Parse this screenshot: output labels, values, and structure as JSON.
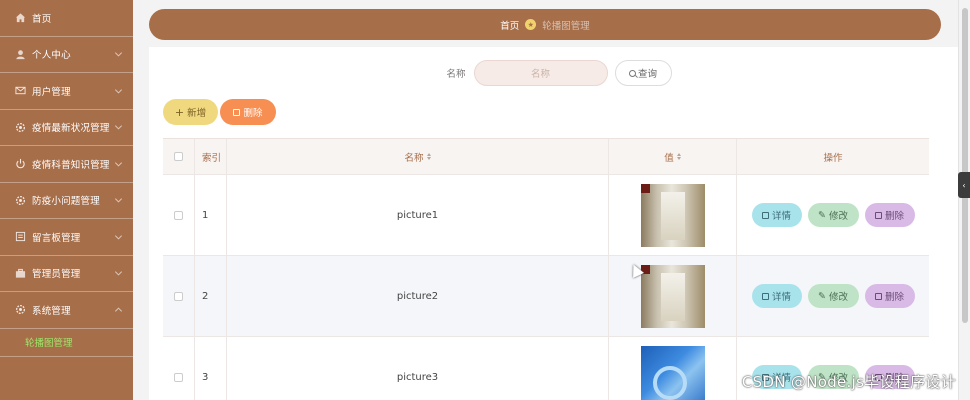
{
  "sidebar": {
    "items": [
      {
        "label": "首页",
        "icon": "home-icon"
      },
      {
        "label": "个人中心",
        "icon": "user-icon"
      },
      {
        "label": "用户管理",
        "icon": "mail-icon"
      },
      {
        "label": "疫情最新状况管理",
        "icon": "gear-icon"
      },
      {
        "label": "疫情科普知识管理",
        "icon": "power-icon"
      },
      {
        "label": "防疫小问题管理",
        "icon": "gear-icon"
      },
      {
        "label": "留言板管理",
        "icon": "list-icon"
      },
      {
        "label": "管理员管理",
        "icon": "briefcase-icon"
      },
      {
        "label": "系统管理",
        "icon": "gear-icon"
      }
    ],
    "sub_items": [
      {
        "label": "轮播图管理"
      }
    ]
  },
  "breadcrumb": {
    "home": "首页",
    "current": "轮播图管理"
  },
  "search": {
    "label": "名称",
    "placeholder": "名称",
    "query_label": "查询"
  },
  "actions": {
    "add_label": "新增",
    "delete_label": "删除"
  },
  "table": {
    "headers": {
      "index": "索引",
      "name": "名称",
      "value": "值",
      "ops": "操作"
    },
    "rows": [
      {
        "index": "1",
        "name": "picture1",
        "image": "hallway"
      },
      {
        "index": "2",
        "name": "picture2",
        "image": "hallway"
      },
      {
        "index": "3",
        "name": "picture3",
        "image": "tech"
      }
    ],
    "op_labels": {
      "detail": "详情",
      "edit": "修改",
      "delete": "删除"
    }
  },
  "watermark": "CSDN @Node.js毕设程序设计",
  "colors": {
    "brand": "#a76e4a",
    "active_sub": "#9de86a",
    "add": "#f0d87f",
    "delete": "#f78e52"
  }
}
